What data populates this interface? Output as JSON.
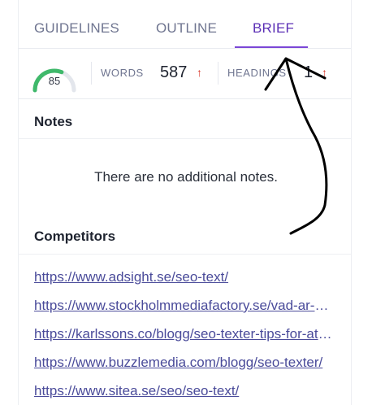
{
  "tabs": [
    {
      "label": "GUIDELINES",
      "active": false
    },
    {
      "label": "OUTLINE",
      "active": false
    },
    {
      "label": "BRIEF",
      "active": true
    }
  ],
  "stats": {
    "score": "85",
    "score_level": 0.62,
    "words_label": "WORDS",
    "words_value": "587",
    "words_trend_icon": "↑",
    "headings_label": "HEADINGS",
    "headings_value": "1",
    "headings_trend_icon": "↑"
  },
  "notes": {
    "title": "Notes",
    "empty_text": "There are no additional notes."
  },
  "competitors": {
    "title": "Competitors",
    "links": [
      "https://www.adsight.se/seo-text/",
      "https://www.stockholmmediafactory.se/vad-ar-seo-text/",
      "https://karlssons.co/blogg/seo-texter-tips-for-att-skriva/",
      "https://www.buzzlemedia.com/blogg/seo-texter/",
      "https://www.sitea.se/seo/seo-text/"
    ]
  },
  "colors": {
    "accent": "#5b2fb5",
    "gauge_fill": "#3fb96b",
    "gauge_track": "#e3e6ec",
    "trend_up": "#d9382a",
    "link": "#4a4b9a"
  }
}
